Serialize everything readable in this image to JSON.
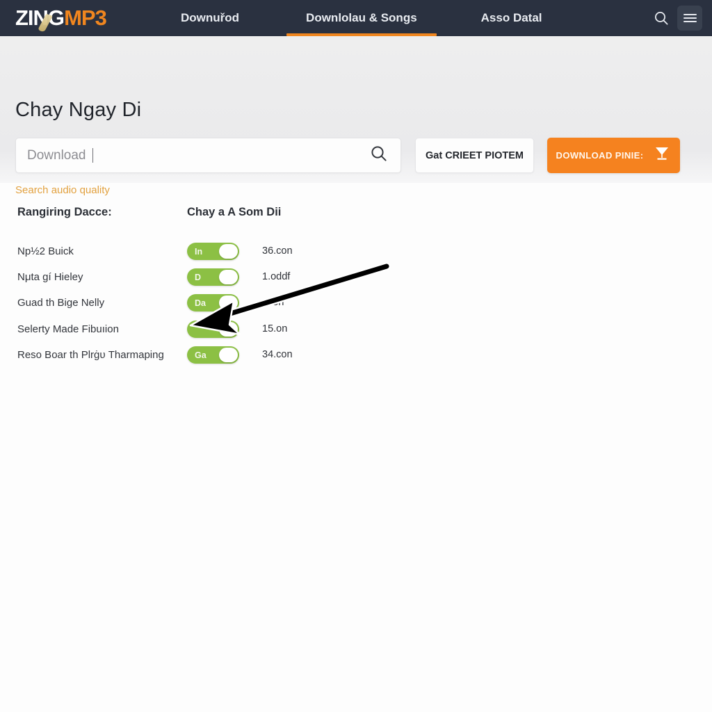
{
  "header": {
    "logo_primary": "ZING",
    "logo_secondary": "MP3",
    "nav": [
      {
        "label": "Downuřod",
        "active": false
      },
      {
        "label": "Downlolau & Songs",
        "active": true
      },
      {
        "label": "Asso Datal",
        "active": false
      }
    ],
    "search_icon": "search-icon",
    "menu_icon": "hamburger-menu-icon"
  },
  "hero": {
    "title": "Chay Ngay Di",
    "search": {
      "value": "Download",
      "placeholder": "Download",
      "icon": "search-icon"
    },
    "secondary_button": "Gat CRIEET PIOTEM",
    "primary_button": "DOWNLOAD PINIE:",
    "primary_button_icon": "download-icon",
    "quality_link": "Search audio quality"
  },
  "content": {
    "heading_left": "Rangiring Dacce:",
    "heading_right": "Chay a A Som Dii",
    "rows": [
      {
        "label": "Np½2 Buick",
        "toggle": "In",
        "value": "36.con"
      },
      {
        "label": "Nμta gí Hieley",
        "toggle": "D",
        "value": "1.oddf"
      },
      {
        "label": "Guad th Bige Nelly",
        "toggle": "Da",
        "value": "..con"
      },
      {
        "label": "Selerty Made Fibuıion",
        "toggle": "",
        "value": "15.on"
      },
      {
        "label": "Reso Boar th Plrġυ Tharmaping",
        "toggle": "Ga",
        "value": "34.con"
      }
    ]
  },
  "colors": {
    "header_bg": "#2a3140",
    "accent_orange": "#f5821f",
    "toggle_green": "#8cc044",
    "link_orange": "#e2a13f"
  },
  "annotation": {
    "arrow": "pointer-arrow"
  }
}
